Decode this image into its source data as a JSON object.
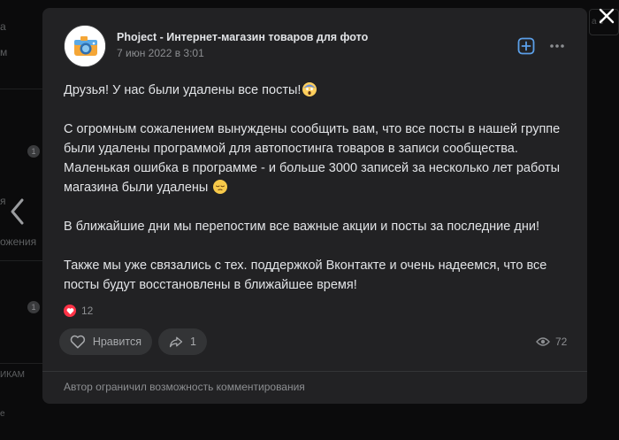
{
  "background": {
    "fragments": [
      "а",
      "м",
      "я",
      "ожения",
      "ИКАМ",
      "е"
    ],
    "badges": [
      "1",
      "1"
    ],
    "right_fragment": "а с"
  },
  "post": {
    "author": "Phoject - Интернет-магазин товаров для фото",
    "date": "7 июн 2022 в 3:01",
    "paragraphs": [
      "Друзья! У нас были удалены все посты!",
      "С огромным сожалением вынуждены сообщить вам, что все посты в нашей группе были удалены программой для автопостинга товаров в записи сообщества. Маленькая ошибка в программе - и больше 3000 записей за несколько лет работы магазина были удалены",
      "В ближайшие дни мы перепостим все важные акции и посты за последние дни!",
      "Также мы уже связались с тех. поддержкой Вконтакте и очень надеемся, что все посты будут восстановлены в ближайшее время!"
    ],
    "emojis": {
      "p1": "face-screaming-icon",
      "p2": "pensive-face-icon"
    },
    "reactions_count": "12",
    "like_label": "Нравится",
    "share_count": "1",
    "views_count": "72",
    "comments_notice": "Автор ограничил возможность комментирования"
  },
  "colors": {
    "modal_bg": "#222224",
    "text": "#e1e3e6",
    "muted": "#8c8e91",
    "accent": "#5b9fe8",
    "reaction": "#ff3347"
  }
}
